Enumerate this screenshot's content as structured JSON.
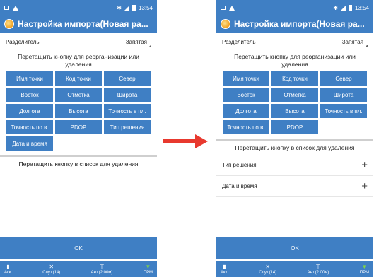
{
  "status": {
    "left_icons": [
      "image-icon",
      "warning-icon"
    ],
    "time": "13:54"
  },
  "left": {
    "title": "Настройка импорта(Новая ра...",
    "separator_label": "Разделитель",
    "separator_value": "Запятая",
    "drag_hint": "Перетащить кнопку для реорганизации или удаления",
    "buttons": [
      "Имя точки",
      "Код точки",
      "Север",
      "Восток",
      "Отметка",
      "Широта",
      "Долгота",
      "Высота",
      "Точность в пл.",
      "Точность по в.",
      "PDOP",
      "Тип решения",
      "Дата и время"
    ],
    "drop_hint": "Перетащить кнопку в список для удаления",
    "ok": "OK"
  },
  "right": {
    "title": "Настройка импорта(Новая ра...",
    "separator_label": "Разделитель",
    "separator_value": "Запятая",
    "drag_hint": "Перетащить кнопку для реорганизации или удаления",
    "buttons": [
      "Имя точки",
      "Код точки",
      "Север",
      "Восток",
      "Отметка",
      "Широта",
      "Долгота",
      "Высота",
      "Точность в пл.",
      "Точность по в.",
      "PDOP"
    ],
    "drop_hint": "Перетащить кнопку в список для удаления",
    "removed": [
      "Тип решения",
      "Дата и время"
    ],
    "ok": "OK"
  },
  "bottom": [
    "Акк.",
    "Спут.(14)",
    "Ант.(2.00м)",
    "ПРМ"
  ],
  "colors": {
    "primary": "#3f7fc4",
    "arrow": "#e8392e",
    "signal": "#7fd24a"
  }
}
